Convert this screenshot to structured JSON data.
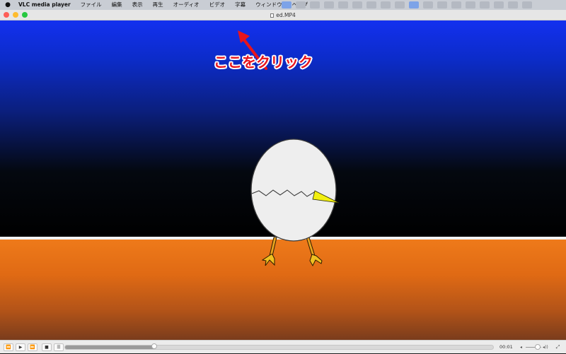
{
  "menubar": {
    "apple_icon": "apple-logo-icon",
    "app_name": "VLC media player",
    "items": [
      "ファイル",
      "編集",
      "表示",
      "再生",
      "オーディオ",
      "ビデオ",
      "字幕",
      "ウィンドウ",
      "ヘルプ"
    ]
  },
  "window": {
    "title": "ed.MP4"
  },
  "annotation": {
    "callout": "ここをクリック",
    "color": "#e8141c"
  },
  "player": {
    "playback_progress": 0.21,
    "elapsed_time": "00:01",
    "volume_level": 0.75,
    "buttons": {
      "rewind": "⏪",
      "play": "▶",
      "fast_forward": "⏩",
      "stop": "■",
      "playlist": "☰"
    },
    "volume_low_icon": "◂",
    "volume_high_icon": "◂))",
    "fullscreen_icon": "⤢"
  }
}
